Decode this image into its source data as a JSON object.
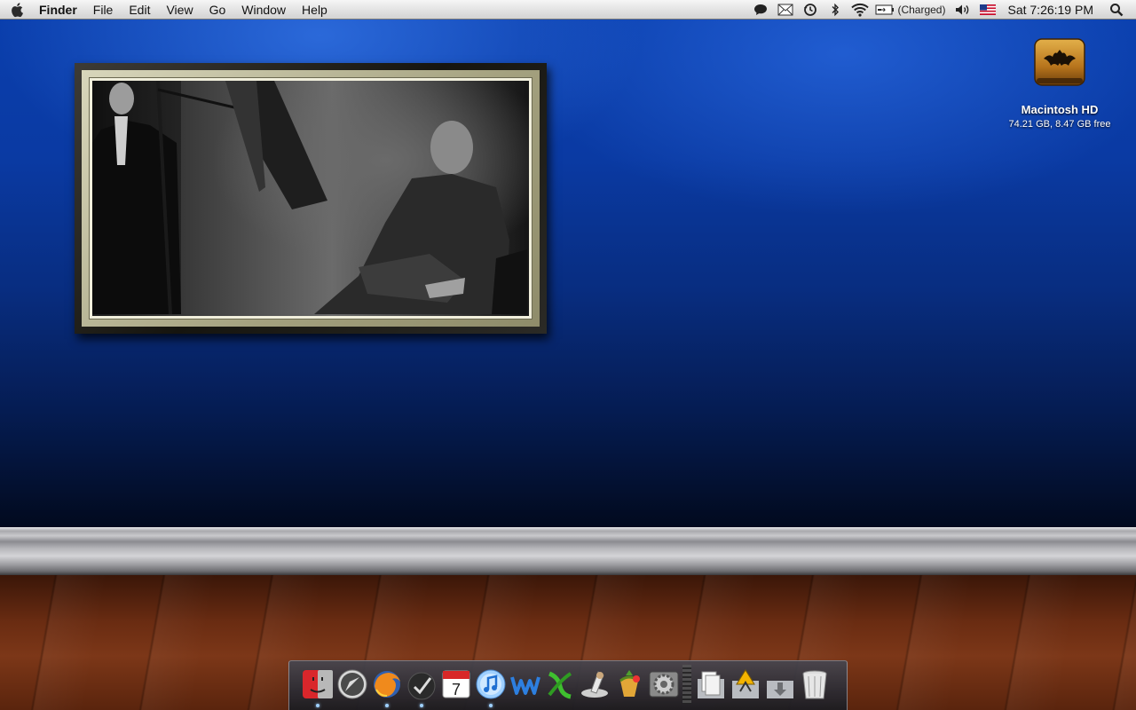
{
  "menubar": {
    "app_name": "Finder",
    "menus": [
      "File",
      "Edit",
      "View",
      "Go",
      "Window",
      "Help"
    ],
    "battery_status": "(Charged)",
    "clock": "Sat 7:26:19 PM",
    "status_icons": [
      "chat-icon",
      "mail-icon",
      "time-machine-icon",
      "bluetooth-icon",
      "wifi-icon",
      "battery-icon",
      "volume-icon",
      "us-flag-input-icon",
      "spotlight-icon"
    ]
  },
  "desktop": {
    "drive": {
      "name": "Macintosh HD",
      "info": "74.21 GB, 8.47 GB free"
    }
  },
  "dock": {
    "apps": [
      {
        "name": "finder-icon",
        "running": true
      },
      {
        "name": "safari-icon",
        "running": false
      },
      {
        "name": "firefox-icon",
        "running": true
      },
      {
        "name": "checkmark-app-icon",
        "running": true
      },
      {
        "name": "ical-icon",
        "running": false,
        "date": "7"
      },
      {
        "name": "itunes-icon",
        "running": true
      },
      {
        "name": "word-icon",
        "running": false
      },
      {
        "name": "excel-icon",
        "running": false
      },
      {
        "name": "preview-icon",
        "running": false
      },
      {
        "name": "adium-icon",
        "running": false
      },
      {
        "name": "system-preferences-icon",
        "running": false
      }
    ],
    "stacks": [
      "documents-stack-icon",
      "applications-stack-icon",
      "downloads-stack-icon",
      "trash-icon"
    ]
  },
  "colors": {
    "wall_blue": "#0a3fae",
    "floor_wood": "#6a2c12"
  }
}
